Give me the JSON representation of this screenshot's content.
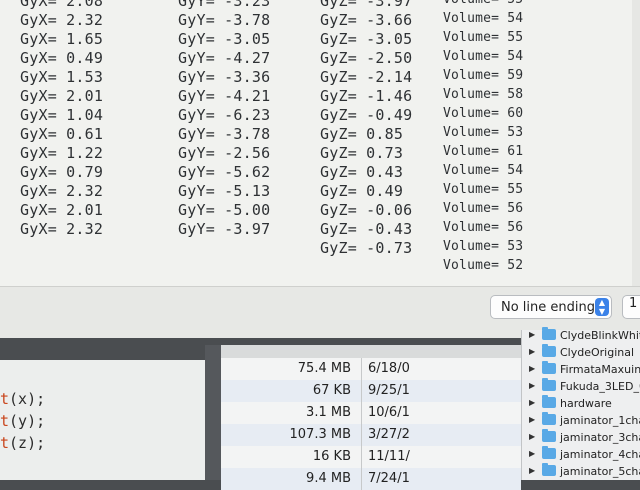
{
  "serial_monitor": {
    "readings": [
      {
        "gx": "GyX= 2.08",
        "gy": "GyY= -3.23",
        "gz": "GyZ= -3.97",
        "vol": "Volume= 55"
      },
      {
        "gx": "GyX= 2.32",
        "gy": "GyY= -3.78",
        "gz": "GyZ= -3.66",
        "vol": "Volume= 54"
      },
      {
        "gx": "GyX= 1.65",
        "gy": "GyY= -3.05",
        "gz": "GyZ= -3.05",
        "vol": "Volume= 55"
      },
      {
        "gx": "GyX= 0.49",
        "gy": "GyY= -4.27",
        "gz": "GyZ= -2.50",
        "vol": "Volume= 54"
      },
      {
        "gx": "GyX= 1.53",
        "gy": "GyY= -3.36",
        "gz": "GyZ= -2.14",
        "vol": "Volume= 59"
      },
      {
        "gx": "GyX= 2.01",
        "gy": "GyY= -4.21",
        "gz": "GyZ= -1.46",
        "vol": "Volume= 58"
      },
      {
        "gx": "GyX= 1.04",
        "gy": "GyY= -6.23",
        "gz": "GyZ= -0.49",
        "vol": "Volume= 60"
      },
      {
        "gx": "GyX= 0.61",
        "gy": "GyY= -3.78",
        "gz": "GyZ= 0.85",
        "vol": "Volume= 53"
      },
      {
        "gx": "GyX= 1.22",
        "gy": "GyY= -2.56",
        "gz": "GyZ= 0.73",
        "vol": "Volume= 61"
      },
      {
        "gx": "GyX= 0.79",
        "gy": "GyY= -5.62",
        "gz": "GyZ= 0.43",
        "vol": "Volume= 54"
      },
      {
        "gx": "GyX= 2.32",
        "gy": "GyY= -5.13",
        "gz": "GyZ= 0.49",
        "vol": "Volume= 55"
      },
      {
        "gx": "GyX= 2.01",
        "gy": "GyY= -5.00",
        "gz": "GyZ= -0.06",
        "vol": "Volume= 56"
      },
      {
        "gx": "GyX= 2.32",
        "gy": "GyY= -3.97",
        "gz": "GyZ= -0.43",
        "vol": "Volume= 56"
      },
      {
        "gx": "",
        "gy": "",
        "gz": "GyZ= -0.73",
        "vol": "Volume= 53"
      },
      {
        "gx": "",
        "gy": "",
        "gz": "",
        "vol": "Volume= 52"
      }
    ],
    "line_ending": "No line ending",
    "baud_partial": "1"
  },
  "code_editor": {
    "lines": [
      {
        "fn": "t",
        "rest": "(x);"
      },
      {
        "fn": "t",
        "rest": "(y);"
      },
      {
        "fn": "t",
        "rest": "(z);"
      }
    ]
  },
  "file_list": {
    "rows": [
      {
        "size": "75.4 MB",
        "date": "6/18/0"
      },
      {
        "size": "67 KB",
        "date": "9/25/1"
      },
      {
        "size": "3.1 MB",
        "date": "10/6/1"
      },
      {
        "size": "107.3 MB",
        "date": "3/27/2"
      },
      {
        "size": "16 KB",
        "date": "11/11/"
      },
      {
        "size": "9.4 MB",
        "date": "7/24/1"
      }
    ]
  },
  "folders": {
    "items": [
      "ClydeBlinkWhite",
      "ClydeOriginal",
      "FirmataMaxuino",
      "Fukuda_3LED_01",
      "hardware",
      "jaminator_1channe",
      "jaminator_3channe",
      "jaminator_4channe",
      "jaminator_5channe"
    ]
  }
}
